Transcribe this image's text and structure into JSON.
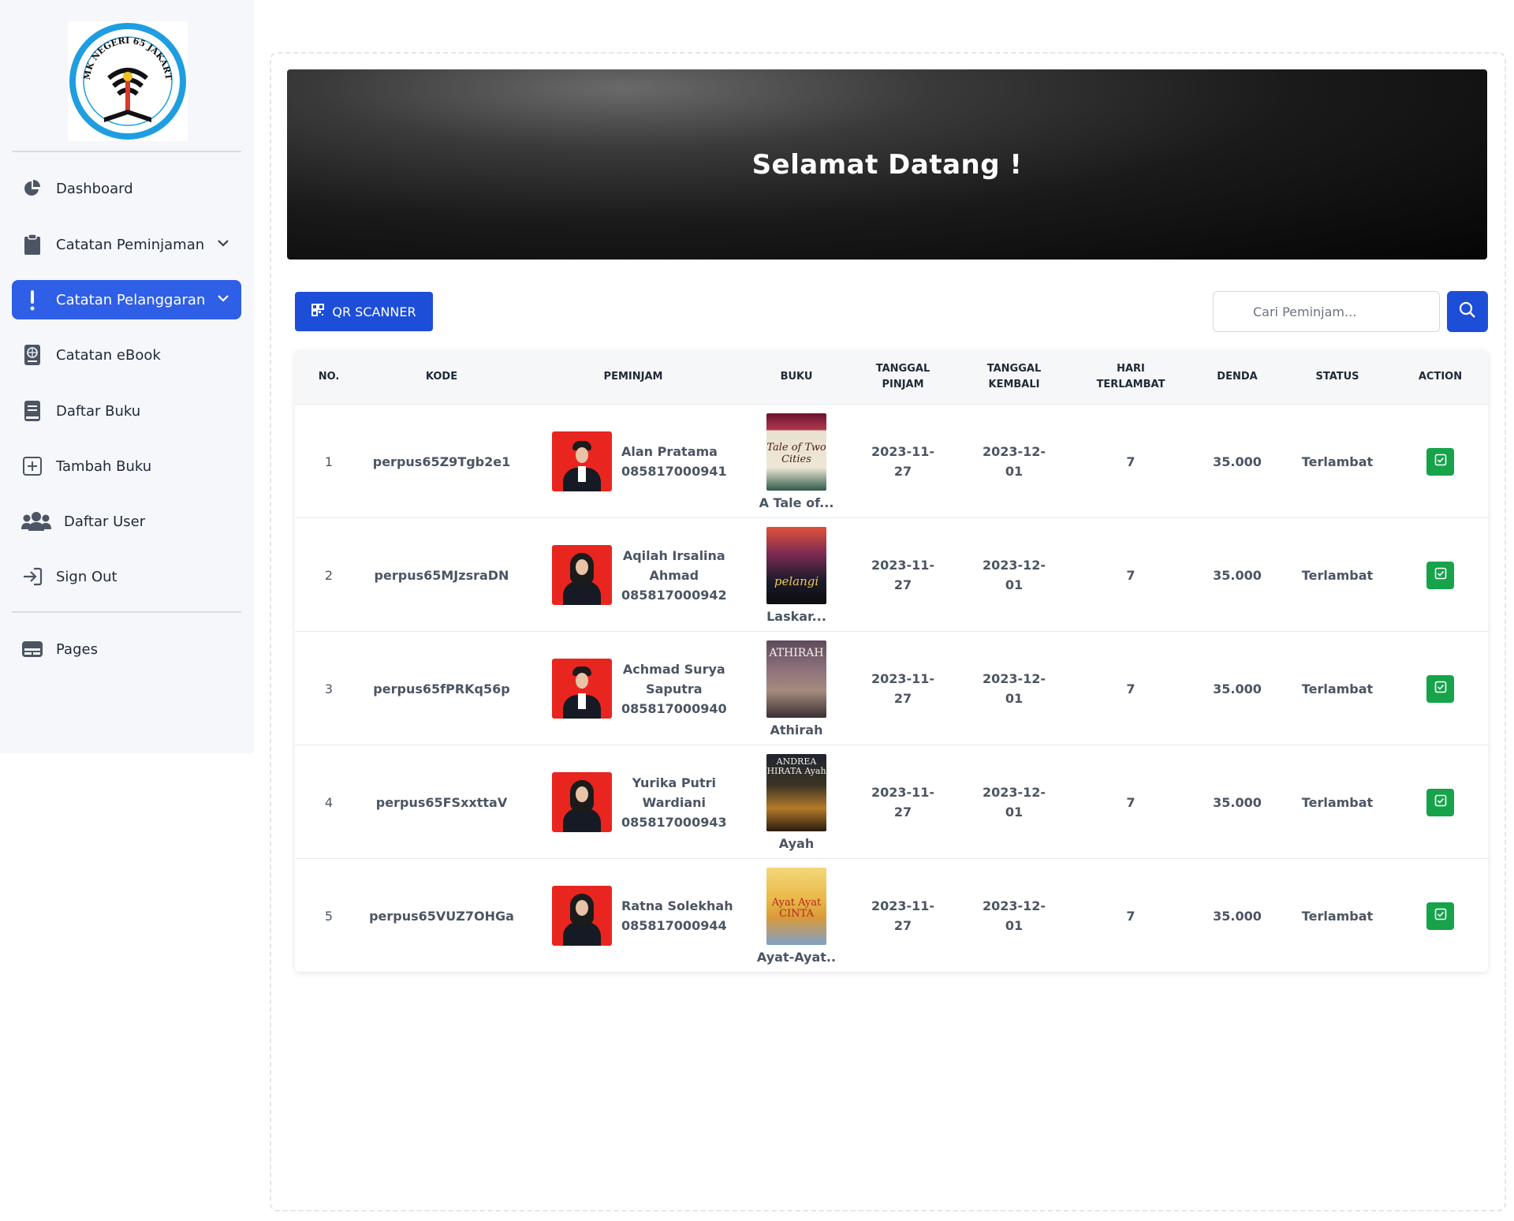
{
  "sidebar": {
    "logo_text": "SMK NEGERI 65 JAKARTA",
    "items": [
      {
        "label": "Dashboard",
        "icon": "pie-chart-icon"
      },
      {
        "label": "Catatan Peminjaman",
        "icon": "clipboard-icon"
      },
      {
        "label": "Catatan Pelanggaran",
        "icon": "exclamation-icon",
        "active": true
      },
      {
        "label": "Catatan eBook",
        "icon": "ebook-icon"
      },
      {
        "label": "Daftar Buku",
        "icon": "book-icon"
      },
      {
        "label": "Tambah Buku",
        "icon": "plus-square-icon"
      },
      {
        "label": "Daftar User",
        "icon": "users-icon"
      },
      {
        "label": "Sign Out",
        "icon": "sign-out-icon"
      },
      {
        "label": "Pages",
        "icon": "pages-icon"
      }
    ]
  },
  "hero": {
    "title": "Selamat Datang !"
  },
  "toolbar": {
    "qr_label": "QR SCANNER",
    "search_placeholder": "Cari Peminjam...",
    "accent": "#1d4ed8"
  },
  "table": {
    "headers": {
      "no": "NO.",
      "kode": "KODE",
      "peminjam": "PEMINJAM",
      "buku": "BUKU",
      "tanggal_pinjam": [
        "TANGGAL",
        "PINJAM"
      ],
      "tanggal_kembali": [
        "TANGGAL",
        "KEMBALI"
      ],
      "hari_terlambat": [
        "HARI",
        "TERLAMBAT"
      ],
      "denda": "DENDA",
      "status": "STATUS",
      "action": "ACTION"
    },
    "rows": [
      {
        "no": "1",
        "kode": "perpus65Z9Tgb2e1",
        "name_lines": [
          "Alan Pratama"
        ],
        "phone": "085817000941",
        "photo": "male",
        "book": "A Tale of...",
        "cover_text": "Tale of Two Cities",
        "pinjam": [
          "2023-11-",
          "27"
        ],
        "kembali": [
          "2023-12-",
          "01"
        ],
        "hari": "7",
        "denda": "35.000",
        "status": "Terlambat"
      },
      {
        "no": "2",
        "kode": "perpus65MJzsraDN",
        "name_lines": [
          "Aqilah Irsalina",
          "Ahmad"
        ],
        "phone": "085817000942",
        "photo": "female",
        "book": "Laskar...",
        "cover_text": "pelangi",
        "pinjam": [
          "2023-11-",
          "27"
        ],
        "kembali": [
          "2023-12-",
          "01"
        ],
        "hari": "7",
        "denda": "35.000",
        "status": "Terlambat"
      },
      {
        "no": "3",
        "kode": "perpus65fPRKq56p",
        "name_lines": [
          "Achmad Surya",
          "Saputra"
        ],
        "phone": "085817000940",
        "photo": "male",
        "book": "Athirah",
        "cover_text": "ATHIRAH",
        "pinjam": [
          "2023-11-",
          "27"
        ],
        "kembali": [
          "2023-12-",
          "01"
        ],
        "hari": "7",
        "denda": "35.000",
        "status": "Terlambat"
      },
      {
        "no": "4",
        "kode": "perpus65FSxxttaV",
        "name_lines": [
          "Yurika Putri",
          "Wardiani"
        ],
        "phone": "085817000943",
        "photo": "female",
        "book": "Ayah",
        "cover_text": "ANDREA HIRATA Ayah",
        "pinjam": [
          "2023-11-",
          "27"
        ],
        "kembali": [
          "2023-12-",
          "01"
        ],
        "hari": "7",
        "denda": "35.000",
        "status": "Terlambat"
      },
      {
        "no": "5",
        "kode": "perpus65VUZ7OHGa",
        "name_lines": [
          "Ratna Solekhah"
        ],
        "phone": "085817000944",
        "photo": "female",
        "book": "Ayat-Ayat..",
        "cover_text": "Ayat Ayat CINTA",
        "pinjam": [
          "2023-11-",
          "27"
        ],
        "kembali": [
          "2023-12-",
          "01"
        ],
        "hari": "7",
        "denda": "35.000",
        "status": "Terlambat"
      }
    ]
  }
}
